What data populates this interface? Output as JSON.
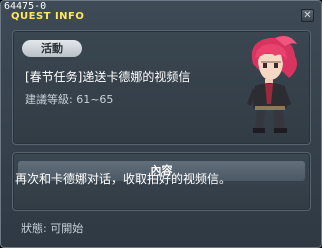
{
  "window": {
    "quest_id": "64475-0",
    "title": "QUEST INFO"
  },
  "quest": {
    "category_pill": "活動",
    "name": "[春节任务]递送卡德娜的视频信",
    "level_requirement": "建議等級: 61~65"
  },
  "content": {
    "header": "內容",
    "description": "再次和卡德娜对话，收取拍好的视频信。"
  },
  "status": {
    "text": "狀態: 可開始"
  },
  "colors": {
    "title": "#ffe760",
    "window_bg": "#36414b",
    "panel_border": "#56636e",
    "character_hair": "#e0406a"
  },
  "icons": {
    "close": "close-icon",
    "character": "npc-character-sprite"
  }
}
